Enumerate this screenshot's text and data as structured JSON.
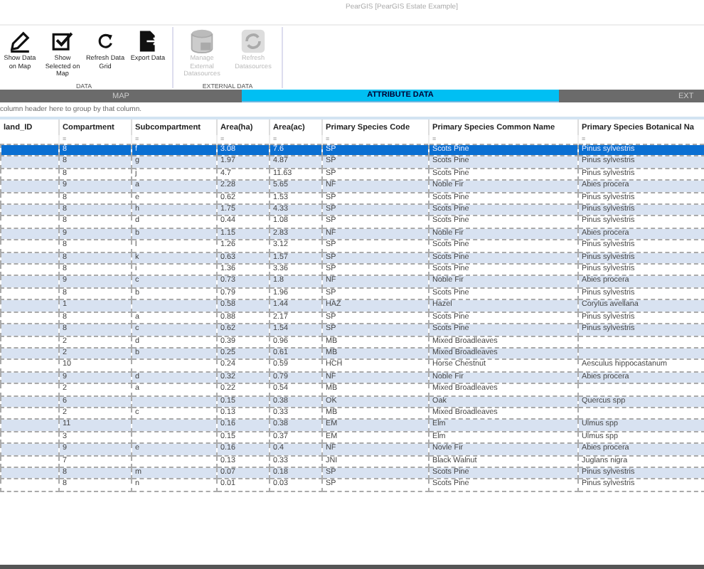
{
  "window": {
    "title": "PearGIS [PearGIS Estate Example]"
  },
  "ribbon": {
    "groups": [
      {
        "label": "DATA",
        "buttons": [
          {
            "label": "Show Data on Map",
            "kind": "pencil",
            "disabled": false
          },
          {
            "label": "Show Selected on Map",
            "kind": "checkbox",
            "disabled": false
          },
          {
            "label": "Refresh Data Grid",
            "kind": "refresh",
            "disabled": false
          },
          {
            "label": "Export Data",
            "kind": "export",
            "disabled": false
          }
        ]
      },
      {
        "label": "EXTERNAL DATA",
        "buttons": [
          {
            "label": "Manage External Datasources",
            "kind": "database",
            "disabled": true
          },
          {
            "label": "Refresh Datasources",
            "kind": "sync",
            "disabled": true
          }
        ]
      }
    ]
  },
  "tabs": [
    {
      "label": "MAP",
      "selected": false
    },
    {
      "label": "ATTRIBUTE DATA",
      "selected": true
    },
    {
      "label": "EXT",
      "selected": false
    }
  ],
  "group_panel": {
    "hint": "column header here to group by that column."
  },
  "table": {
    "columns": [
      {
        "label": "land_ID"
      },
      {
        "label": "Compartment",
        "filter": "="
      },
      {
        "label": "Subcompartment",
        "filter": "="
      },
      {
        "label": "Area(ha)",
        "filter": "="
      },
      {
        "label": "Area(ac)",
        "filter": "="
      },
      {
        "label": "Primary Species Code",
        "filter": "="
      },
      {
        "label": "Primary Species Common Name",
        "filter": "="
      },
      {
        "label": "Primary Species Botanical Na",
        "filter": "="
      }
    ],
    "rows": [
      {
        "selected": true,
        "cells": [
          "",
          "8",
          "f",
          "3.08",
          "7.6",
          "SP",
          "Scots Pine",
          "Pinus sylvestris"
        ]
      },
      {
        "selected": false,
        "cells": [
          "",
          "8",
          "g",
          "1.97",
          "4.87",
          "SP",
          "Scots Pine",
          "Pinus sylvestris"
        ]
      },
      {
        "selected": false,
        "cells": [
          "",
          "8",
          "j",
          "4.7",
          "11.63",
          "SP",
          "Scots Pine",
          "Pinus sylvestris"
        ]
      },
      {
        "selected": false,
        "cells": [
          "",
          "9",
          "a",
          "2.28",
          "5.65",
          "NF",
          "Noble Fir",
          "Abies procera"
        ]
      },
      {
        "selected": false,
        "cells": [
          "",
          "8",
          "e",
          "0.62",
          "1.53",
          "SP",
          "Scots Pine",
          "Pinus sylvestris"
        ]
      },
      {
        "selected": false,
        "cells": [
          "",
          "8",
          "h",
          "1.75",
          "4.33",
          "SP",
          "Scots Pine",
          "Pinus sylvestris"
        ]
      },
      {
        "selected": false,
        "cells": [
          "",
          "8",
          "d",
          "0.44",
          "1.08",
          "SP",
          "Scots Pine",
          "Pinus sylvestris"
        ]
      },
      {
        "selected": false,
        "cells": [
          "",
          "9",
          "b",
          "1.15",
          "2.83",
          "NF",
          "Noble Fir",
          "Abies procera"
        ]
      },
      {
        "selected": false,
        "cells": [
          "",
          "8",
          "l",
          "1.26",
          "3.12",
          "SP",
          "Scots Pine",
          "Pinus sylvestris"
        ]
      },
      {
        "selected": false,
        "cells": [
          "",
          "8",
          "k",
          "0.63",
          "1.57",
          "SP",
          "Scots Pine",
          "Pinus sylvestris"
        ]
      },
      {
        "selected": false,
        "cells": [
          "",
          "8",
          "i",
          "1.36",
          "3.36",
          "SP",
          "Scots Pine",
          "Pinus sylvestris"
        ]
      },
      {
        "selected": false,
        "cells": [
          "",
          "9",
          "c",
          "0.73",
          "1.8",
          "NF",
          "Noble Fir",
          "Abies procera"
        ]
      },
      {
        "selected": false,
        "cells": [
          "",
          "8",
          "b",
          "0.79",
          "1.96",
          "SP",
          "Scots Pine",
          "Pinus sylvestris"
        ]
      },
      {
        "selected": false,
        "cells": [
          "",
          "1",
          "",
          "0.58",
          "1.44",
          "HAZ",
          "Hazel",
          "Corylus avellana"
        ]
      },
      {
        "selected": false,
        "cells": [
          "",
          "8",
          "a",
          "0.88",
          "2.17",
          "SP",
          "Scots Pine",
          "Pinus sylvestris"
        ]
      },
      {
        "selected": false,
        "cells": [
          "",
          "8",
          "c",
          "0.62",
          "1.54",
          "SP",
          "Scots Pine",
          "Pinus sylvestris"
        ]
      },
      {
        "selected": false,
        "cells": [
          "",
          "2",
          "d",
          "0.39",
          "0.96",
          "MB",
          "Mixed Broadleaves",
          ""
        ]
      },
      {
        "selected": false,
        "cells": [
          "",
          "2",
          "b",
          "0.25",
          "0.61",
          "MB",
          "Mixed Broadleaves",
          ""
        ]
      },
      {
        "selected": false,
        "cells": [
          "",
          "10",
          "",
          "0.24",
          "0.59",
          "HCH",
          "Horse Chestnut",
          "Aesculus hippocastanum"
        ]
      },
      {
        "selected": false,
        "cells": [
          "",
          "9",
          "d",
          "0.32",
          "0.79",
          "NF",
          "Noble Fir",
          "Abies procera"
        ]
      },
      {
        "selected": false,
        "cells": [
          "",
          "2",
          "a",
          "0.22",
          "0.54",
          "MB",
          "Mixed Broadleaves",
          ""
        ]
      },
      {
        "selected": false,
        "cells": [
          "",
          "6",
          "",
          "0.15",
          "0.38",
          "OK",
          "Oak",
          "Quercus spp"
        ]
      },
      {
        "selected": false,
        "cells": [
          "",
          "2",
          "c",
          "0.13",
          "0.33",
          "MB",
          "Mixed Broadleaves",
          ""
        ]
      },
      {
        "selected": false,
        "cells": [
          "",
          "11",
          "",
          "0.16",
          "0.38",
          "EM",
          "Elm",
          "Ulmus spp"
        ]
      },
      {
        "selected": false,
        "cells": [
          "",
          "3",
          "",
          "0.15",
          "0.37",
          "EM",
          "Elm",
          "Ulmus spp"
        ]
      },
      {
        "selected": false,
        "cells": [
          "",
          "9",
          "e",
          "0.16",
          "0.4",
          "NF",
          "Novle Fir",
          "Abies procera"
        ]
      },
      {
        "selected": false,
        "cells": [
          "",
          "7",
          "",
          "0.13",
          "0.33",
          "JNI",
          "Black Walnut",
          "Juglans nigra"
        ]
      },
      {
        "selected": false,
        "cells": [
          "",
          "8",
          "m",
          "0.07",
          "0.18",
          "SP",
          "Scots Pine",
          "Pinus sylvestris"
        ]
      },
      {
        "selected": false,
        "cells": [
          "",
          "8",
          "n",
          "0.01",
          "0.03",
          "SP",
          "Scots Pine",
          "Pinus sylvestris"
        ]
      }
    ]
  }
}
